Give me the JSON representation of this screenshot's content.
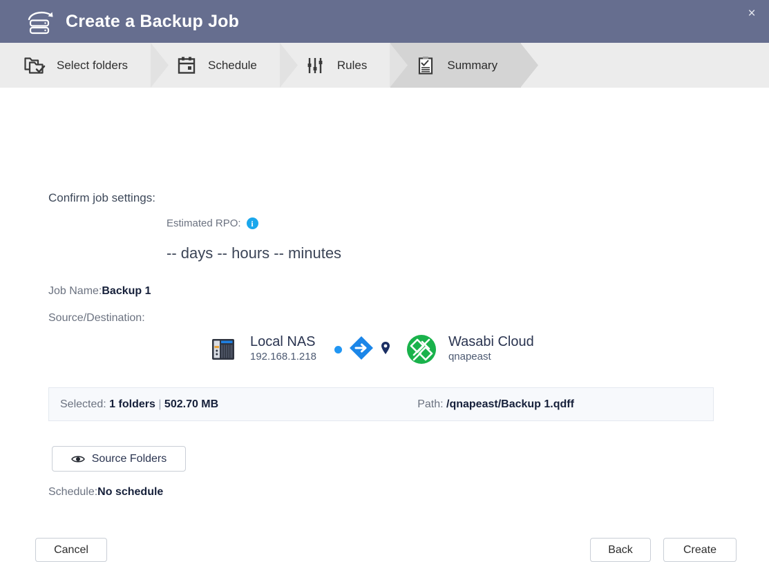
{
  "window": {
    "title": "Create a Backup Job",
    "logo_icon": "nas-backup-icon",
    "close_icon": "×",
    "titlebar_color": "#666e8f"
  },
  "steps": [
    {
      "label": "Select folders",
      "icon": "folders-check-icon",
      "active": false
    },
    {
      "label": "Schedule",
      "icon": "calendar-icon",
      "active": false
    },
    {
      "label": "Rules",
      "icon": "sliders-icon",
      "active": false
    },
    {
      "label": "Summary",
      "icon": "clipboard-check-icon",
      "active": true
    }
  ],
  "summary": {
    "confirm_title": "Confirm job settings:",
    "rpo": {
      "label": "Estimated RPO:",
      "info_icon": "info-icon",
      "info_glyph": "i",
      "value": "-- days -- hours -- minutes"
    },
    "job_name": {
      "label": "Job Name:",
      "value": "Backup 1"
    },
    "source_destination_label": "Source/Destination:",
    "source": {
      "icon": "nas-device-icon",
      "title": "Local NAS",
      "subtitle": "192.168.1.218"
    },
    "flow": {
      "dot_icon": "flow-dot-icon",
      "arrow_icon": "arrow-right-diamond-icon",
      "pin_icon": "map-pin-icon",
      "accent_color": "#2196f3"
    },
    "destination": {
      "icon": "wasabi-cloud-icon",
      "title": "Wasabi Cloud",
      "subtitle": "qnapeast",
      "brand_color": "#19b24b"
    },
    "info_bar": {
      "selected_label": "Selected:",
      "selected_folders": "1 folders",
      "separator": "|",
      "selected_size": "502.70 MB",
      "path_label": "Path:",
      "path_value": "/qnapeast/Backup 1.qdff"
    },
    "source_folders_button": {
      "label": "Source Folders",
      "icon": "eye-icon"
    },
    "schedule": {
      "label": "Schedule:",
      "value": "No schedule"
    }
  },
  "footer": {
    "cancel_label": "Cancel",
    "back_label": "Back",
    "create_label": "Create"
  }
}
